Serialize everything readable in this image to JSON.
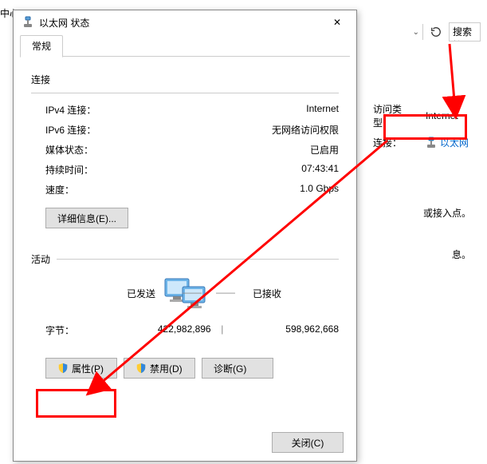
{
  "dialog": {
    "title": "以太网 状态",
    "tab": "常规",
    "section_connection": "连接",
    "rows": {
      "ipv4": {
        "label": "IPv4 连接：",
        "value": "Internet"
      },
      "ipv6": {
        "label": "IPv6 连接：",
        "value": "无网络访问权限"
      },
      "media": {
        "label": "媒体状态：",
        "value": "已启用"
      },
      "duration": {
        "label": "持续时间：",
        "value": "07:43:41"
      },
      "speed": {
        "label": "速度：",
        "value": "1.0 Gbps"
      }
    },
    "details_btn": "详细信息(E)...",
    "section_activity": "活动",
    "sent_label": "已发送",
    "recv_label": "已接收",
    "bytes_label": "字节：",
    "bytes_sent": "422,982,896",
    "bytes_sep": "|",
    "bytes_recv": "598,962,668",
    "btn_properties": "属性(P)",
    "btn_disable": "禁用(D)",
    "btn_diagnose": "诊断(G)",
    "btn_close": "关闭(C)"
  },
  "bg": {
    "top_fragment": "中心",
    "search_placeholder": "搜索控",
    "access_type_label": "访问类型：",
    "access_type_value": "Internet",
    "connection_label": "连接：",
    "connection_link": "以太网",
    "text1": "或接入点。",
    "text2": "息。"
  }
}
